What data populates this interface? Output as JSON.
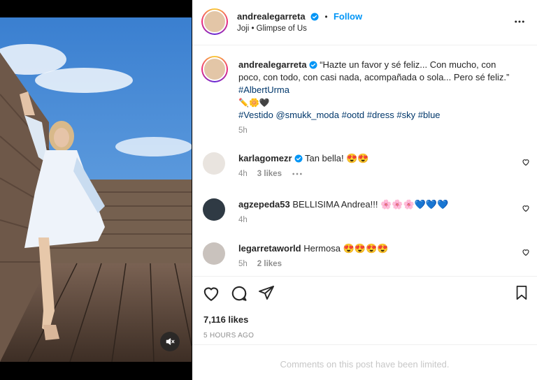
{
  "post": {
    "username": "andrealegarreta",
    "follow_label": "Follow",
    "separator": "•",
    "audio": "Joji • Glimpse of Us",
    "caption_lines": [
      "“Hazte un favor y sé feliz... Con mucho, con",
      "poco, con todo, con casi nada, acompañada o sola... Pero sé feliz.”"
    ],
    "caption_hashtag": "#AlbertUrma",
    "caption_emojis": "✏️🌼🖤",
    "caption_tags": "#Vestido @smukk_moda #ootd #dress #sky #blue",
    "caption_time": "5h"
  },
  "comments": [
    {
      "username": "karlagomezr",
      "verified": true,
      "text": "Tan bella! 😍😍",
      "time": "4h",
      "likes": "3 likes",
      "has_more": true,
      "avatar_color": "#e9e4df"
    },
    {
      "username": "agzepeda53",
      "verified": false,
      "text": "BELLISIMA Andrea!!! 🌸🌸🌸💙💙💙",
      "time": "4h",
      "likes": "",
      "has_more": false,
      "avatar_color": "#2f3a44"
    },
    {
      "username": "legarretaworld",
      "verified": false,
      "text": "Hermosa 😍😍😍😍",
      "time": "5h",
      "likes": "2 likes",
      "has_more": false,
      "avatar_color": "#c9c2bd"
    }
  ],
  "stats": {
    "likes": "7,116 likes",
    "time_ago": "5 HOURS AGO"
  },
  "footer": {
    "comments_limited": "Comments on this post have been limited."
  },
  "colors": {
    "link_blue": "#0095f6",
    "hashtag": "#00376b",
    "sky": "#3f86d6",
    "deck": "#6b5446"
  }
}
